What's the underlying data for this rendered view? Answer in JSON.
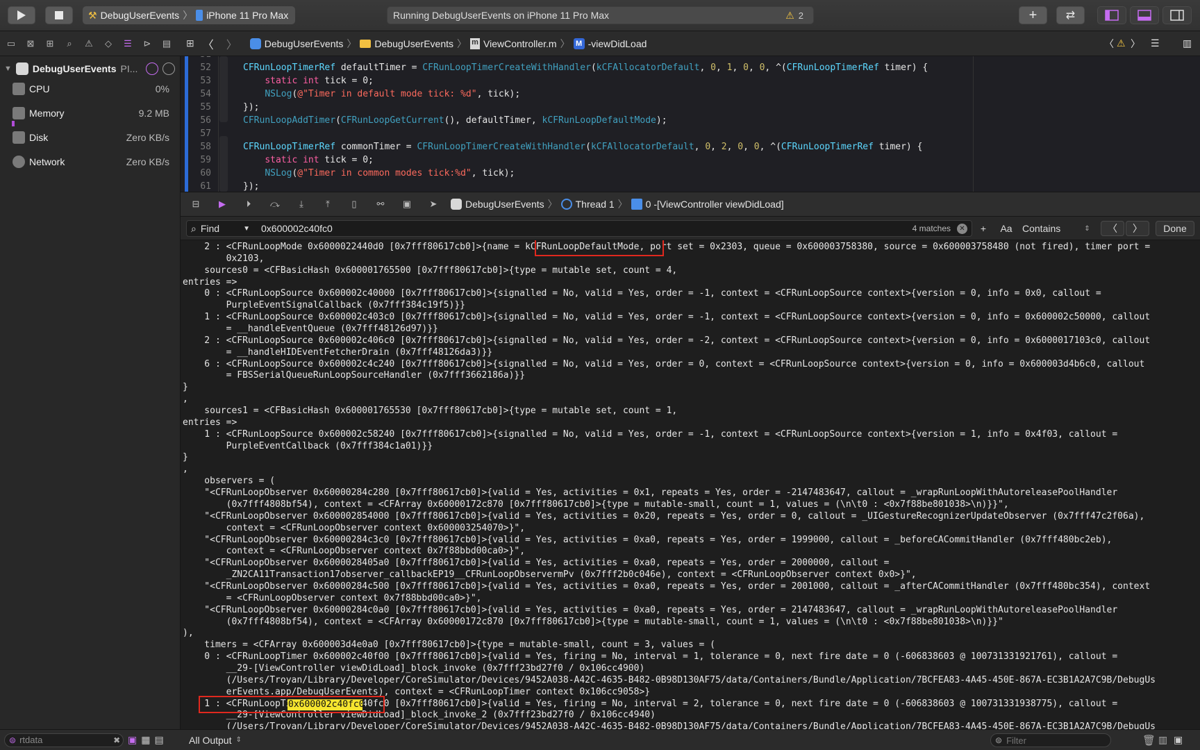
{
  "toolbar": {
    "scheme_target": "DebugUserEvents",
    "scheme_device": "iPhone 11 Pro Max",
    "activity_text": "Running DebugUserEvents on iPhone 11 Pro Max",
    "warning_count": "2"
  },
  "navigator": {
    "process_name": "DebugUserEvents",
    "process_suffix": "PI...",
    "gauges": [
      {
        "label": "CPU",
        "value": "0%",
        "level": 0.0
      },
      {
        "label": "Memory",
        "value": "9.2 MB",
        "level": 0.02
      },
      {
        "label": "Disk",
        "value": "Zero KB/s",
        "level": 0.0
      },
      {
        "label": "Network",
        "value": "Zero KB/s",
        "level": 0.0
      }
    ],
    "filter_value": "rtdata"
  },
  "jumpbar": {
    "crumbs": [
      "DebugUserEvents",
      "DebugUserEvents",
      "ViewController.m",
      "-viewDidLoad"
    ]
  },
  "editor": {
    "lines": [
      {
        "n": "51",
        "code": ""
      },
      {
        "n": "52",
        "code": "CFRunLoopTimerRef defaultTimer = CFRunLoopTimerCreateWithHandler(kCFAllocatorDefault, 0, 1, 0, 0, ^(CFRunLoopTimerRef timer) {"
      },
      {
        "n": "53",
        "code": "    static int tick = 0;"
      },
      {
        "n": "54",
        "code": "    NSLog(@\"Timer in default mode tick: %d\", tick);"
      },
      {
        "n": "55",
        "code": "});"
      },
      {
        "n": "56",
        "code": "CFRunLoopAddTimer(CFRunLoopGetCurrent(), defaultTimer, kCFRunLoopDefaultMode);"
      },
      {
        "n": "57",
        "code": ""
      },
      {
        "n": "58",
        "code": "CFRunLoopTimerRef commonTimer = CFRunLoopTimerCreateWithHandler(kCFAllocatorDefault, 0, 2, 0, 0, ^(CFRunLoopTimerRef timer) {"
      },
      {
        "n": "59",
        "code": "    static int tick = 0;"
      },
      {
        "n": "60",
        "code": "    NSLog(@\"Timer in common modes tick:%d\", tick);"
      },
      {
        "n": "61",
        "code": "});"
      }
    ]
  },
  "debugbar": {
    "target": "DebugUserEvents",
    "thread": "Thread 1",
    "frame": "0 -[ViewController viewDidLoad]"
  },
  "findbar": {
    "mode": "Find",
    "query": "0x600002c40fc0",
    "matches": "4 matches",
    "case_label": "Aa",
    "match_type": "Contains",
    "done_label": "Done"
  },
  "console": {
    "lines": [
      "    2 : <CFRunLoopMode 0x6000022440d0 [0x7fff80617cb0]>{name = kCFRunLoopDefaultMode, port set = 0x2303, queue = 0x600003758380, source = 0x600003758480 (not fired), timer port =",
      "        0x2103,",
      "    sources0 = <CFBasicHash 0x600001765500 [0x7fff80617cb0]>{type = mutable set, count = 4,",
      "entries =>",
      "    0 : <CFRunLoopSource 0x600002c40000 [0x7fff80617cb0]>{signalled = No, valid = Yes, order = -1, context = <CFRunLoopSource context>{version = 0, info = 0x0, callout =",
      "        PurpleEventSignalCallback (0x7fff384c19f5)}}",
      "    1 : <CFRunLoopSource 0x600002c403c0 [0x7fff80617cb0]>{signalled = No, valid = Yes, order = -1, context = <CFRunLoopSource context>{version = 0, info = 0x600002c50000, callout",
      "        = __handleEventQueue (0x7fff48126d97)}}",
      "    2 : <CFRunLoopSource 0x600002c406c0 [0x7fff80617cb0]>{signalled = No, valid = Yes, order = -2, context = <CFRunLoopSource context>{version = 0, info = 0x6000017103c0, callout",
      "        = __handleHIDEventFetcherDrain (0x7fff48126da3)}}",
      "    6 : <CFRunLoopSource 0x600002c4c240 [0x7fff80617cb0]>{signalled = No, valid = Yes, order = 0, context = <CFRunLoopSource context>{version = 0, info = 0x600003d4b6c0, callout",
      "        = FBSSerialQueueRunLoopSourceHandler (0x7fff3662186a)}}",
      "}",
      ",",
      "    sources1 = <CFBasicHash 0x600001765530 [0x7fff80617cb0]>{type = mutable set, count = 1,",
      "entries =>",
      "    1 : <CFRunLoopSource 0x600002c58240 [0x7fff80617cb0]>{signalled = No, valid = Yes, order = -1, context = <CFRunLoopSource context>{version = 1, info = 0x4f03, callout =",
      "        PurpleEventCallback (0x7fff384c1a01)}}",
      "}",
      ",",
      "    observers = (",
      "    \"<CFRunLoopObserver 0x60000284c280 [0x7fff80617cb0]>{valid = Yes, activities = 0x1, repeats = Yes, order = -2147483647, callout = _wrapRunLoopWithAutoreleasePoolHandler",
      "        (0x7fff4808bf54), context = <CFArray 0x60000172c870 [0x7fff80617cb0]>{type = mutable-small, count = 1, values = (\\n\\t0 : <0x7f88be801038>\\n)}}\",",
      "    \"<CFRunLoopObserver 0x600002854000 [0x7fff80617cb0]>{valid = Yes, activities = 0x20, repeats = Yes, order = 0, callout = _UIGestureRecognizerUpdateObserver (0x7fff47c2f06a),",
      "        context = <CFRunLoopObserver context 0x600003254070>}\",",
      "    \"<CFRunLoopObserver 0x60000284c3c0 [0x7fff80617cb0]>{valid = Yes, activities = 0xa0, repeats = Yes, order = 1999000, callout = _beforeCACommitHandler (0x7fff480bc2eb),",
      "        context = <CFRunLoopObserver context 0x7f88bbd00ca0>}\",",
      "    \"<CFRunLoopObserver 0x6000028405a0 [0x7fff80617cb0]>{valid = Yes, activities = 0xa0, repeats = Yes, order = 2000000, callout =",
      "        _ZN2CA11Transaction17observer_callbackEP19__CFRunLoopObservermPv (0x7fff2b0c046e), context = <CFRunLoopObserver context 0x0>}\",",
      "    \"<CFRunLoopObserver 0x60000284c500 [0x7fff80617cb0]>{valid = Yes, activities = 0xa0, repeats = Yes, order = 2001000, callout = _afterCACommitHandler (0x7fff480bc354), context",
      "        = <CFRunLoopObserver context 0x7f88bbd00ca0>}\",",
      "    \"<CFRunLoopObserver 0x60000284c0a0 [0x7fff80617cb0]>{valid = Yes, activities = 0xa0, repeats = Yes, order = 2147483647, callout = _wrapRunLoopWithAutoreleasePoolHandler",
      "        (0x7fff4808bf54), context = <CFArray 0x60000172c870 [0x7fff80617cb0]>{type = mutable-small, count = 1, values = (\\n\\t0 : <0x7f88be801038>\\n)}}\"",
      "),",
      "    timers = <CFArray 0x600003d4e0a0 [0x7fff80617cb0]>{type = mutable-small, count = 3, values = (",
      "    0 : <CFRunLoopTimer 0x600002c40f00 [0x7fff80617cb0]>{valid = Yes, firing = No, interval = 1, tolerance = 0, next fire date = 0 (-606838603 @ 100731331921761), callout =",
      "        __29-[ViewController viewDidLoad]_block_invoke (0x7fff23bd27f0 / 0x106cc4900)",
      "        (/Users/Troyan/Library/Developer/CoreSimulator/Devices/9452A038-A42C-4635-B482-0B98D130AF75/data/Containers/Bundle/Application/7BCFEA83-4A45-450E-867A-EC3B1A2A7C9B/DebugUs",
      "        erEvents.app/DebugUserEvents), context = <CFRunLoopTimer context 0x106cc9058>}",
      "    1 : <CFRunLoopTimer 0x600002c40fc0 [0x7fff80617cb0]>{valid = Yes, firing = No, interval = 2, tolerance = 0, next fire date = 0 (-606838603 @ 100731331938775), callout =",
      "        __29-[ViewController viewDidLoad]_block_invoke_2 (0x7fff23bd27f0 / 0x106cc4940)",
      "        (/Users/Troyan/Library/Developer/CoreSimulator/Devices/9452A038-A42C-4635-B482-0B98D130AF75/data/Containers/Bundle/Application/7BCFEA83-4A45-450E-867A-EC3B1A2A7C9B/DebugUs"
    ],
    "highlight_default_mode": "kCFRunLoopDefaultMode",
    "highlight_timer_prefix": "<CFRunLoopTimer ",
    "highlight_match": "0x600002c40fc0"
  },
  "outbar": {
    "output_mode": "All Output",
    "filter_placeholder": "Filter"
  }
}
